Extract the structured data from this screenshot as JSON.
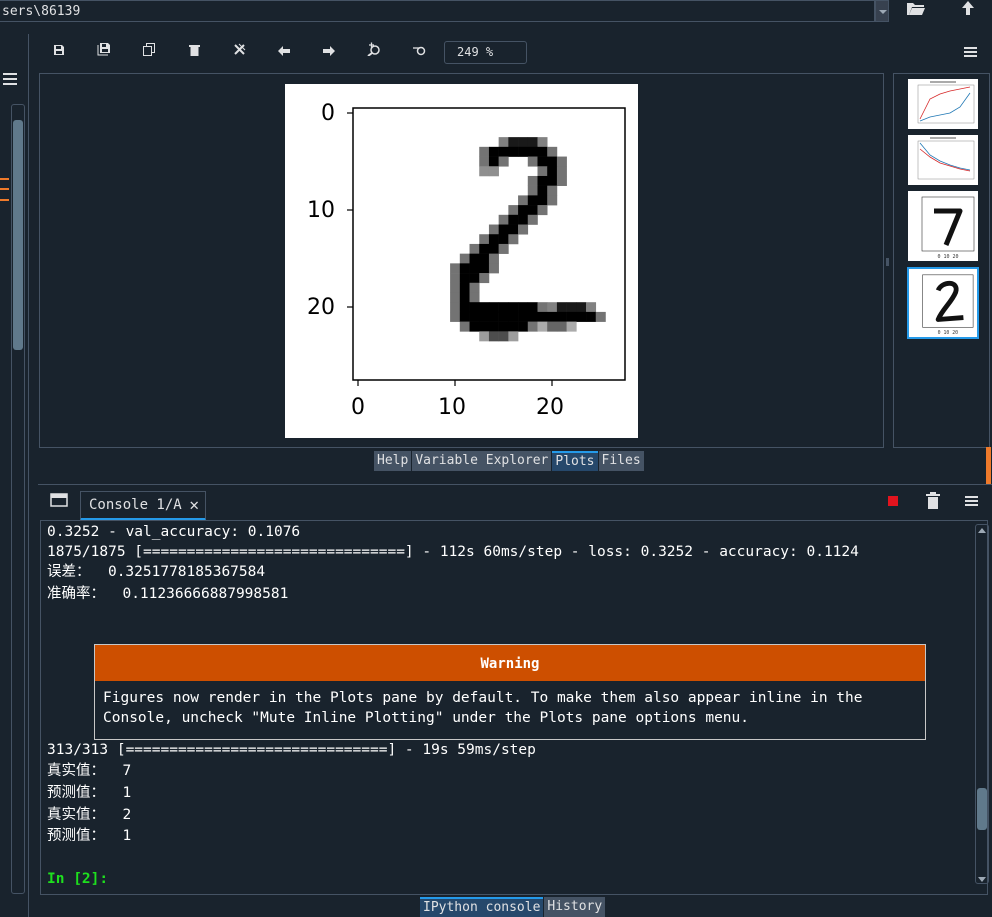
{
  "path_bar": {
    "value": "sers\\86139"
  },
  "plots_toolbar": {
    "zoom": "249 %",
    "icons": [
      "save-icon",
      "save-all-icon",
      "copy-icon",
      "trash-icon",
      "close-all-icon",
      "arrow-left-icon",
      "arrow-right-icon",
      "zoom-in-icon",
      "zoom-out-icon"
    ]
  },
  "figure": {
    "yticks": [
      "0",
      "10",
      "20"
    ],
    "xticks": [
      "0",
      "10",
      "20"
    ]
  },
  "thumbnails": [
    {
      "kind": "line-chart",
      "colors": [
        "#d62728",
        "#1f77b4"
      ]
    },
    {
      "kind": "line-chart",
      "colors": [
        "#1f77b4",
        "#d62728"
      ]
    },
    {
      "kind": "digit",
      "digit": "7"
    },
    {
      "kind": "digit",
      "digit": "2",
      "selected": true
    }
  ],
  "pane_tabs": [
    "Help",
    "Variable Explorer",
    "Plots",
    "Files"
  ],
  "pane_tabs_active": "Plots",
  "console": {
    "tab_label": "Console 1/A",
    "close": "✕",
    "lines": [
      "0.3252 - val_accuracy: 0.1076",
      "1875/1875 [==============================] - 112s 60ms/step - loss: 0.3252 - accuracy: 0.1124",
      "误差：  0.3251778185367584",
      "准确率：  0.11236666887998581"
    ],
    "warning": {
      "title": "Warning",
      "text": "Figures now render in the Plots pane by default. To make them also appear inline in the Console, uncheck \"Mute Inline Plotting\" under the Plots pane options menu."
    },
    "lines_after": [
      "313/313 [==============================] - 19s 59ms/step",
      "真实值：  7",
      "预测值：  1",
      "真实值：  2",
      "预测值：  1"
    ],
    "prompt": "In [2]:"
  },
  "bottom_tabs": [
    "IPython console",
    "History"
  ],
  "bottom_tabs_active": "IPython console",
  "colors": {
    "accent": "#259ae9",
    "warning": "#cd4f00",
    "prompt": "#1ee01e",
    "stop": "#e2141e",
    "background": "#19232d"
  }
}
